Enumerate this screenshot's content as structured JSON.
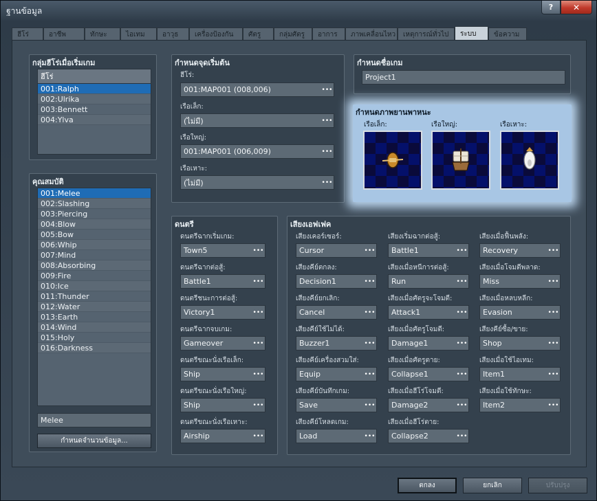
{
  "window": {
    "title": "ฐานข้อมูล",
    "help_label": "?",
    "close_label": "✕"
  },
  "tabs": [
    "ฮีโร่",
    "อาชีพ",
    "ทักษะ",
    "ไอเทม",
    "อาวุธ",
    "เครื่องป้องกัน",
    "ศัตรู",
    "กลุ่มศัตรู",
    "อาการ",
    "ภาพเคลื่อนไหว",
    "เหตุการณ์ทั่วไป",
    "ระบบ",
    "ข้อความ"
  ],
  "active_tab": "ระบบ",
  "start_party": {
    "title": "กลุ่มฮีโร่เมื่อเริ่มเกม",
    "header": "ฮีโร่",
    "items": [
      "001:Ralph",
      "002:Ulrika",
      "003:Bennett",
      "004:Ylva"
    ]
  },
  "attributes": {
    "title": "คุณสมบัติ",
    "items": [
      "001:Melee",
      "002:Slashing",
      "003:Piercing",
      "004:Blow",
      "005:Bow",
      "006:Whip",
      "007:Mind",
      "008:Absorbing",
      "009:Fire",
      "010:Ice",
      "011:Thunder",
      "012:Water",
      "013:Earth",
      "014:Wind",
      "015:Holy",
      "016:Darkness"
    ],
    "name_value": "Melee",
    "max_button": "กำหนดจำนวนข้อมูล..."
  },
  "start_pos": {
    "title": "กำหนดจุดเริ่มต้น",
    "hero_label": "ฮีโร่:",
    "hero_value": "001:MAP001 (008,006)",
    "boat_label": "เรือเล็ก:",
    "boat_value": "(ไม่มี)",
    "ship_label": "เรือใหญ่:",
    "ship_value": "001:MAP001 (006,009)",
    "airship_label": "เรือเหาะ:",
    "airship_value": "(ไม่มี)"
  },
  "game_title": {
    "title": "กำหนดชื่อเกม",
    "value": "Project1"
  },
  "vehicle_graphics": {
    "title": "กำหนดภาพยานพาหนะ",
    "boat_label": "เรือเล็ก:",
    "ship_label": "เรือใหญ่:",
    "airship_label": "เรือเหาะ:"
  },
  "music": {
    "title": "ดนตรี",
    "items": [
      {
        "label": "ดนตรีฉากเริ่มเกม:",
        "value": "Town5"
      },
      {
        "label": "ดนตรีฉากต่อสู้:",
        "value": "Battle1"
      },
      {
        "label": "ดนตรีชนะการต่อสู้:",
        "value": "Victory1"
      },
      {
        "label": "ดนตรีฉากจบเกม:",
        "value": "Gameover"
      },
      {
        "label": "ดนตรีขณะนั่งเรือเล็ก:",
        "value": "Ship"
      },
      {
        "label": "ดนตรีขณะนั่งเรือใหญ่:",
        "value": "Ship"
      },
      {
        "label": "ดนตรีขณะนั่งเรือเหาะ:",
        "value": "Airship"
      }
    ]
  },
  "sfx": {
    "title": "เสียงเอฟเฟค",
    "col1": [
      {
        "label": "เสียงเคอร์เซอร์:",
        "value": "Cursor"
      },
      {
        "label": "เสียงคีย์ตกลง:",
        "value": "Decision1"
      },
      {
        "label": "เสียงคีย์ยกเลิก:",
        "value": "Cancel"
      },
      {
        "label": "เสียงคีย์ใช้ไม่ได้:",
        "value": "Buzzer1"
      },
      {
        "label": "เสียงคีย์เครื่องสวมใส่:",
        "value": "Equip"
      },
      {
        "label": "เสียงคีย์บันทึกเกม:",
        "value": "Save"
      },
      {
        "label": "เสียงคีย์โหลดเกม:",
        "value": "Load"
      }
    ],
    "col2": [
      {
        "label": "เสียงเริ่มฉากต่อสู้:",
        "value": "Battle1"
      },
      {
        "label": "เสียงเมื่อหนีการต่อสู้:",
        "value": "Run"
      },
      {
        "label": "เสียงเมื่อศัตรูจะโจมตี:",
        "value": "Attack1"
      },
      {
        "label": "เสียงเมื่อศัตรูโจมตี:",
        "value": "Damage1"
      },
      {
        "label": "เสียงเมื่อศัตรูตาย:",
        "value": "Collapse1"
      },
      {
        "label": "เสียงเมื่อฮีโร่โจมตี:",
        "value": "Damage2"
      },
      {
        "label": "เสียงเมื่อฮีโร่ตาย:",
        "value": "Collapse2"
      }
    ],
    "col3": [
      {
        "label": "เสียงเมื่อฟื้นพลัง:",
        "value": "Recovery"
      },
      {
        "label": "เสียงเมื่อโจมตีพลาด:",
        "value": "Miss"
      },
      {
        "label": "เสียงเมื่อหลบหลีก:",
        "value": "Evasion"
      },
      {
        "label": "เสียงคีย์ซื้อ/ขาย:",
        "value": "Shop"
      },
      {
        "label": "เสียงเมื่อใช้ไอเทม:",
        "value": "Item1"
      },
      {
        "label": "เสียงเมื่อใช้ทักษะ:",
        "value": "Item2"
      }
    ]
  },
  "footer": {
    "ok": "ตกลง",
    "cancel": "ยกเลิก",
    "apply": "ปรับปรุง"
  },
  "dots": "•••"
}
